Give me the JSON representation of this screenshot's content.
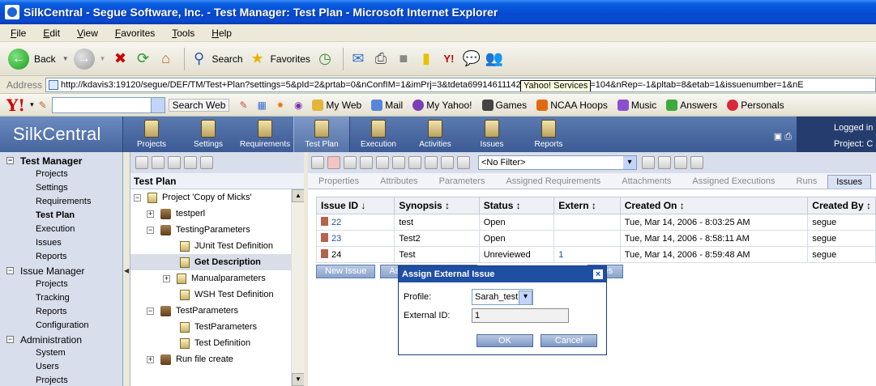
{
  "window": {
    "title": "SilkCentral - Segue Software, Inc. - Test Manager: Test Plan - Microsoft Internet Explorer"
  },
  "menubar": [
    "File",
    "Edit",
    "View",
    "Favorites",
    "Tools",
    "Help"
  ],
  "toolbar": {
    "back_label": "Back",
    "search_label": "Search",
    "favorites_label": "Favorites"
  },
  "addressbar": {
    "label": "Address",
    "url": "http://kdavis3:19120/segue/DEF/TM/Test+Plan?settings=5&pId=2&prtab=0&nConfIM=1&imPrj=3&tdeta",
    "url_tail": "6991461114234197626 8&nTP=104&nRep=-1&pltab=8&etab=1&issuenumber=1&nE",
    "tooltip": "Yahoo! Services"
  },
  "yahoobar": {
    "search_button": "Search Web",
    "items": [
      "My Web",
      "Mail",
      "My Yahoo!",
      "Games",
      "NCAA Hoops",
      "Music",
      "Answers",
      "Personals"
    ]
  },
  "app": {
    "brand": "SilkCentral",
    "tabs": [
      "Projects",
      "Settings",
      "Requirements",
      "Test Plan",
      "Execution",
      "Activities",
      "Issues",
      "Reports"
    ],
    "active_tab": "Test Plan",
    "user_line1": "Logged in a",
    "user_line2": "Project: C"
  },
  "leftnav": {
    "groups": [
      {
        "label": "Test Manager",
        "items": [
          "Projects",
          "Settings",
          "Requirements",
          "Test Plan",
          "Execution",
          "Issues",
          "Reports"
        ]
      },
      {
        "label": "Issue Manager",
        "items": [
          "Projects",
          "Tracking",
          "Reports",
          "Configuration"
        ]
      },
      {
        "label": "Administration",
        "items": [
          "System",
          "Users",
          "Projects"
        ]
      }
    ],
    "current": "Test Plan"
  },
  "tree": {
    "header": "Test Plan",
    "rows": [
      {
        "label": "Project 'Copy of Micks'",
        "toggle": "⊟",
        "level": 0,
        "icon": "project"
      },
      {
        "label": "testperl",
        "toggle": "+",
        "level": 1,
        "icon": "folder"
      },
      {
        "label": "TestingParameters",
        "toggle": "−",
        "level": 1,
        "icon": "folder"
      },
      {
        "label": "JUnit Test Definition",
        "toggle": "",
        "level": 2,
        "icon": "test"
      },
      {
        "label": "Get Description",
        "toggle": "",
        "level": 2,
        "icon": "test",
        "selected": true
      },
      {
        "label": "Manualparameters",
        "toggle": "+",
        "level": 2,
        "icon": "test"
      },
      {
        "label": "WSH Test Definition",
        "toggle": "",
        "level": 2,
        "icon": "test"
      },
      {
        "label": "TestParameters",
        "toggle": "−",
        "level": 1,
        "icon": "folder"
      },
      {
        "label": "TestParameters",
        "toggle": "",
        "level": 2,
        "icon": "test"
      },
      {
        "label": "Test Definition",
        "toggle": "",
        "level": 2,
        "icon": "test"
      },
      {
        "label": "Run file create",
        "toggle": "+",
        "level": 1,
        "icon": "folder"
      }
    ]
  },
  "main": {
    "filter": "<No Filter>",
    "subtabs": [
      "Properties",
      "Attributes",
      "Parameters",
      "Assigned Requirements",
      "Attachments",
      "Assigned Executions",
      "Runs",
      "Issues"
    ],
    "active_subtab": "Issues",
    "table": {
      "columns": [
        "Issue ID ↓",
        "Synopsis ↕",
        "Status ↕",
        "Extern ↕",
        "Created On ↕",
        "Created By ↕"
      ],
      "rows": [
        {
          "id": "22",
          "synopsis": "test",
          "status": "Open",
          "extern": "",
          "created_on": "Tue, Mar 14, 2006 - 8:03:25 AM",
          "created_by": "segue"
        },
        {
          "id": "23",
          "synopsis": "Test2",
          "status": "Open",
          "extern": "",
          "created_on": "Tue, Mar 14, 2006 - 8:58:11 AM",
          "created_by": "segue"
        },
        {
          "id": "24",
          "synopsis": "Test",
          "status": "Unreviewed",
          "extern": "1",
          "created_on": "Tue, Mar 14, 2006 - 8:59:48 AM",
          "created_by": "segue"
        }
      ]
    },
    "buttons": [
      "New Issue",
      "As",
      "ues"
    ]
  },
  "dialog": {
    "title": "Assign External Issue",
    "profile_label": "Profile:",
    "profile_value": "Sarah_test",
    "external_id_label": "External ID:",
    "external_id_value": "1",
    "ok": "OK",
    "cancel": "Cancel"
  }
}
